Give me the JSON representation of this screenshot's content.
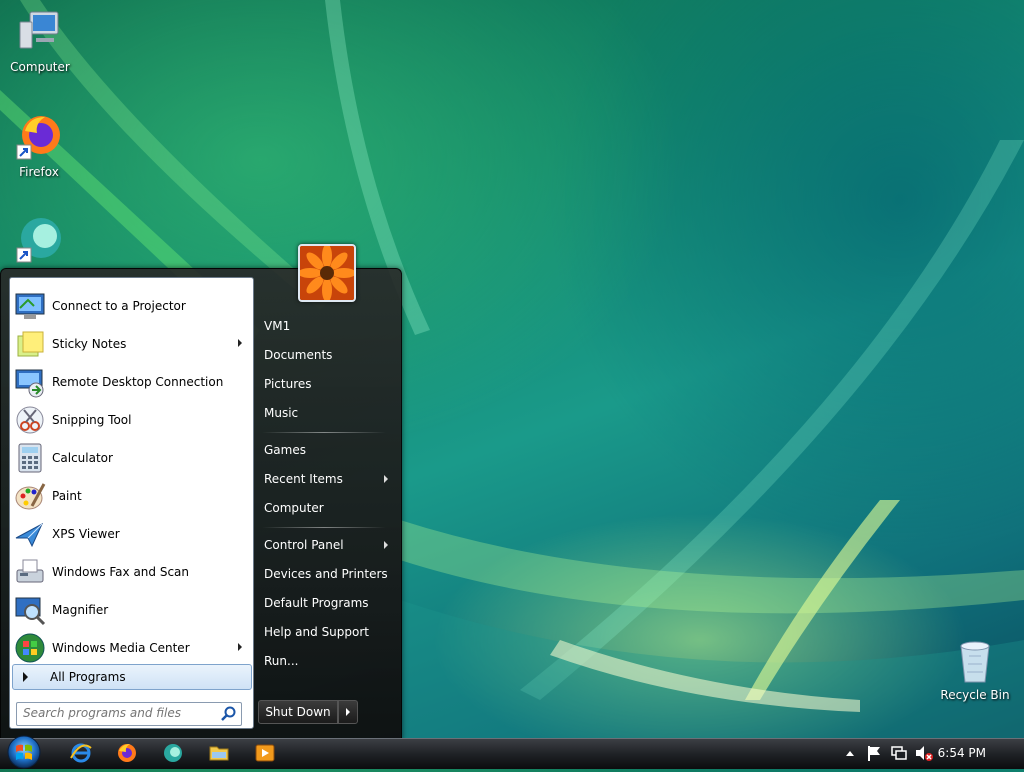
{
  "desktop": {
    "icons": [
      {
        "label": "Computer"
      },
      {
        "label": "Firefox"
      },
      {
        "label": ""
      },
      {
        "label": "Recycle Bin"
      }
    ]
  },
  "start_menu": {
    "programs": [
      {
        "label": "Connect to a Projector",
        "icon": "projector-icon",
        "submenu": false
      },
      {
        "label": "Sticky Notes",
        "icon": "sticky-notes-icon",
        "submenu": true
      },
      {
        "label": "Remote Desktop Connection",
        "icon": "remote-desktop-icon",
        "submenu": false
      },
      {
        "label": "Snipping Tool",
        "icon": "scissors-icon",
        "submenu": false
      },
      {
        "label": "Calculator",
        "icon": "calculator-icon",
        "submenu": false
      },
      {
        "label": "Paint",
        "icon": "paint-palette-icon",
        "submenu": false
      },
      {
        "label": "XPS Viewer",
        "icon": "xps-viewer-icon",
        "submenu": false
      },
      {
        "label": "Windows Fax and Scan",
        "icon": "fax-icon",
        "submenu": false
      },
      {
        "label": "Magnifier",
        "icon": "magnifier-icon",
        "submenu": false
      },
      {
        "label": "Windows Media Center",
        "icon": "media-center-icon",
        "submenu": true
      }
    ],
    "all_programs_label": "All Programs",
    "search_placeholder": "Search programs and files",
    "right_items": [
      {
        "label": "VM1",
        "submenu": false
      },
      {
        "label": "Documents",
        "submenu": false
      },
      {
        "label": "Pictures",
        "submenu": false
      },
      {
        "label": "Music",
        "submenu": false
      },
      {
        "label": "Games",
        "submenu": false
      },
      {
        "label": "Recent Items",
        "submenu": true
      },
      {
        "label": "Computer",
        "submenu": false
      },
      {
        "label": "Control Panel",
        "submenu": true
      },
      {
        "label": "Devices and Printers",
        "submenu": false
      },
      {
        "label": "Default Programs",
        "submenu": false
      },
      {
        "label": "Help and Support",
        "submenu": false
      },
      {
        "label": "Run...",
        "submenu": false
      }
    ],
    "shutdown_label": "Shut Down"
  },
  "taskbar": {
    "pinned": [
      "internet-explorer-icon",
      "firefox-icon",
      "app-icon",
      "folder-icon",
      "media-player-icon"
    ],
    "clock": "6:54 PM"
  },
  "colors": {
    "accent": "#2a7ad8",
    "menu_bg": "#1b1b1b",
    "wallpaper_green": "#12876a"
  }
}
